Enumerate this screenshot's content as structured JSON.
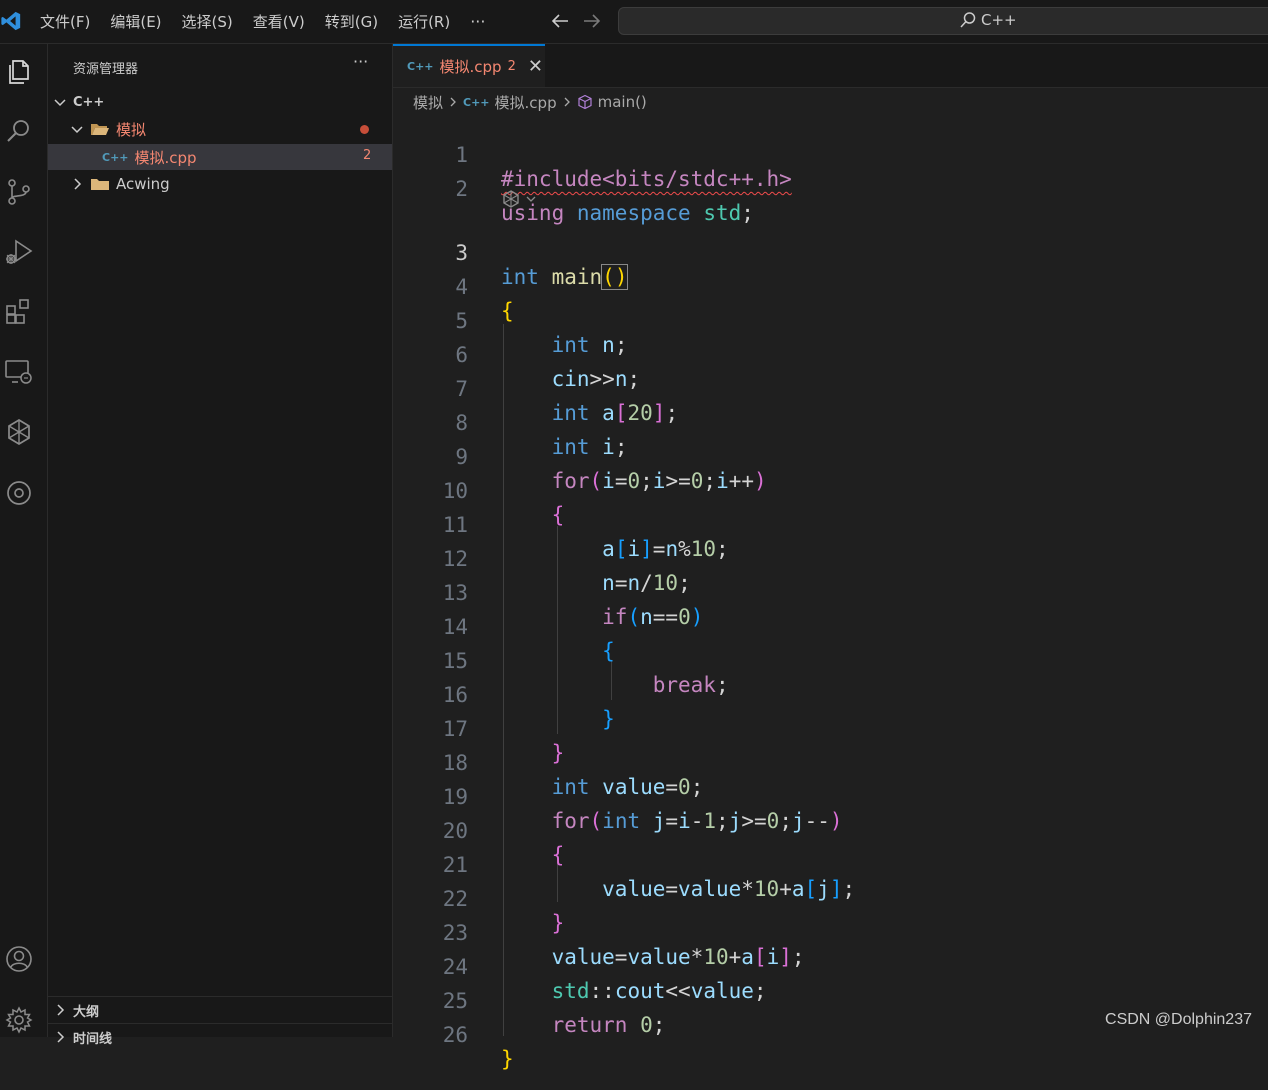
{
  "colors": {
    "accent": "#0078d4",
    "error": "#f48771"
  },
  "menu": [
    "文件(F)",
    "编辑(E)",
    "选择(S)",
    "查看(V)",
    "转到(G)",
    "运行(R)"
  ],
  "menu_more": "···",
  "search": {
    "text": "C++"
  },
  "explorer": {
    "title": "资源管理器",
    "more": "···",
    "root": "C++",
    "items": [
      {
        "label": "模拟",
        "type": "folder",
        "expanded": true,
        "error": true
      },
      {
        "label": "模拟.cpp",
        "type": "file",
        "badge": "2",
        "icon": "C++"
      },
      {
        "label": "Acwing",
        "type": "folder",
        "expanded": false
      }
    ]
  },
  "panels": [
    "大纲",
    "时间线"
  ],
  "tab": {
    "label": "模拟.cpp",
    "count": "2",
    "icon": "C++",
    "close": "✕"
  },
  "breadcrumb": {
    "folder": "模拟",
    "file": "模拟.cpp",
    "symbol": "main()",
    "icon": "C++"
  },
  "code": {
    "line_numbers": [
      "1",
      "2",
      "3",
      "4",
      "5",
      "6",
      "7",
      "8",
      "9",
      "10",
      "11",
      "12",
      "13",
      "14",
      "15",
      "16",
      "17",
      "18",
      "19",
      "20",
      "21",
      "22",
      "23",
      "24",
      "25",
      "26"
    ],
    "active_line": "3",
    "lines": [
      "#include<bits/stdc++.h>",
      "using namespace std;",
      "int main()",
      "{",
      "    int n;",
      "    cin>>n;",
      "    int a[20];",
      "    int i;",
      "    for(i=0;i>=0;i++)",
      "    {",
      "        a[i]=n%10;",
      "        n=n/10;",
      "        if(n==0)",
      "        {",
      "            break;",
      "        }",
      "    }",
      "    int value=0;",
      "    for(int j=i-1;j>=0;j--)",
      "    {",
      "        value=value*10+a[j];",
      "    }",
      "    value=value*10+a[i];",
      "    std::cout<<value;",
      "    return 0;",
      "}"
    ]
  },
  "watermark": "CSDN @Dolphin237"
}
